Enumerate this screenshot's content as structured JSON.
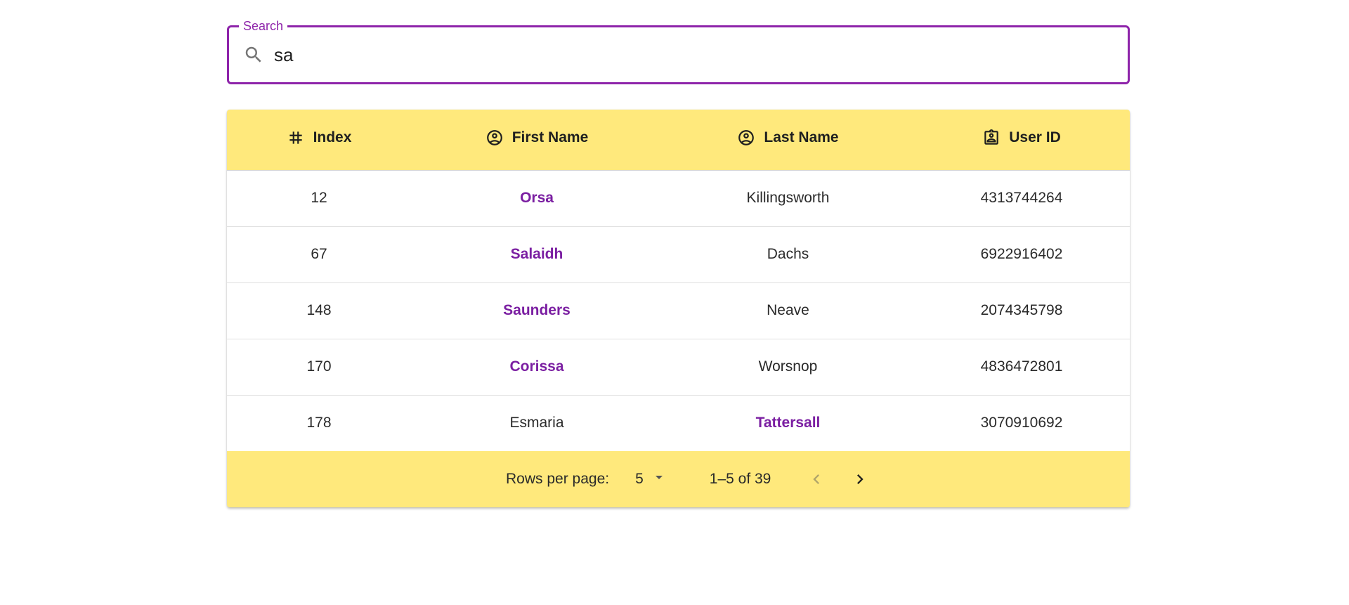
{
  "search": {
    "legend": "Search",
    "value": "sa",
    "icon": "search-icon"
  },
  "table": {
    "columns": [
      {
        "label": "Index",
        "icon": "hash-icon"
      },
      {
        "label": "First Name",
        "icon": "account-circle-icon"
      },
      {
        "label": "Last Name",
        "icon": "account-circle-icon"
      },
      {
        "label": "User ID",
        "icon": "badge-icon"
      }
    ],
    "rows": [
      {
        "index": "12",
        "first_name": "Orsa",
        "last_name": "Killingsworth",
        "user_id": "4313744264",
        "match": "first_name"
      },
      {
        "index": "67",
        "first_name": "Salaidh",
        "last_name": "Dachs",
        "user_id": "6922916402",
        "match": "first_name"
      },
      {
        "index": "148",
        "first_name": "Saunders",
        "last_name": "Neave",
        "user_id": "2074345798",
        "match": "first_name"
      },
      {
        "index": "170",
        "first_name": "Corissa",
        "last_name": "Worsnop",
        "user_id": "4836472801",
        "match": "first_name"
      },
      {
        "index": "178",
        "first_name": "Esmaria",
        "last_name": "Tattersall",
        "user_id": "3070910692",
        "match": "last_name"
      }
    ]
  },
  "pagination": {
    "rows_per_page_label": "Rows per page:",
    "rows_per_page_value": "5",
    "range_text": "1–5 of 39",
    "prev_icon": "chevron-left-icon",
    "next_icon": "chevron-right-icon"
  },
  "colors": {
    "accent": "#8e24aa",
    "highlight_text": "#7b1fa2",
    "header_bg": "#ffe97c"
  }
}
